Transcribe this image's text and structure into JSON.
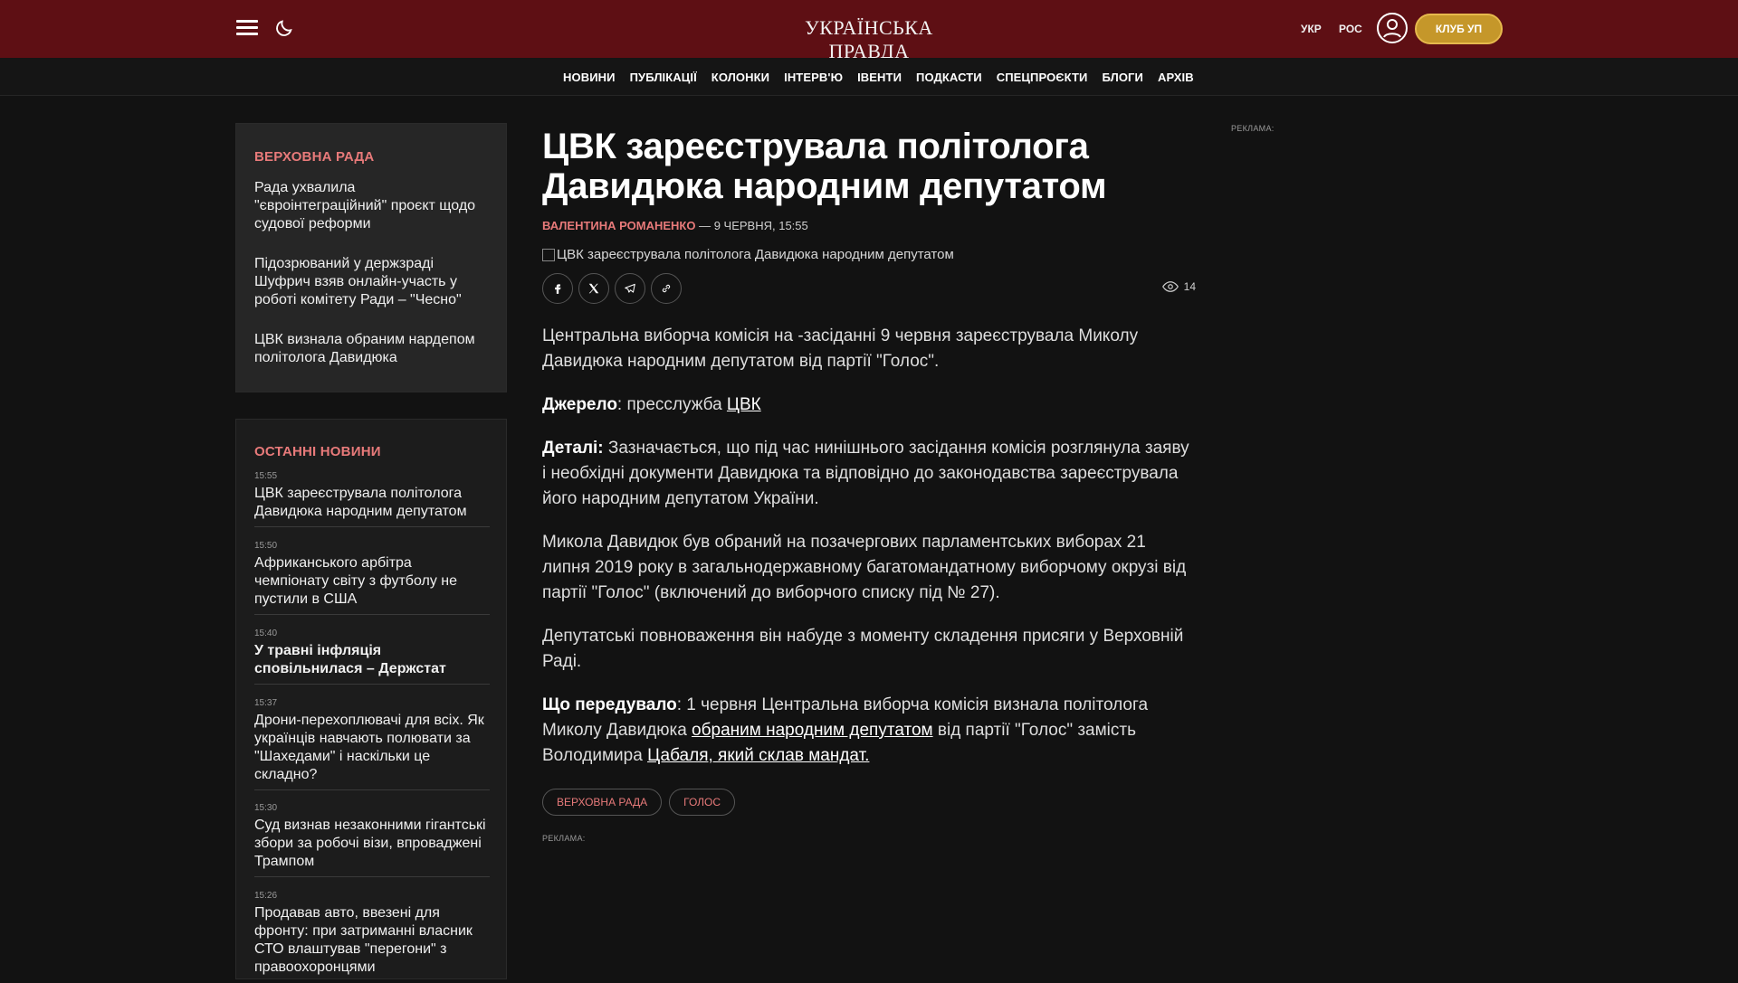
{
  "header": {
    "logo": "УКРАЇНСЬКА ПРАВДА",
    "lang_ukr": "УКР",
    "lang_ros": "РОС",
    "club": "КЛУБ УП"
  },
  "nav": [
    "НОВИНИ",
    "ПУБЛІКАЦІЇ",
    "КОЛОНКИ",
    "ІНТЕРВ'Ю",
    "ІВЕНТИ",
    "ПОДКАСТИ",
    "СПЕЦПРОЄКТИ",
    "БЛОГИ",
    "АРХІВ"
  ],
  "rada_box": {
    "title": "ВЕРХОВНА РАДА",
    "items": [
      "Рада ухвалила \"євроінтеграційний\" проєкт щодо судової реформи",
      "Підозрюваний у держзраді Шуфрич взяв онлайн-участь у роботі комітету Ради – \"Чесно\"",
      "ЦВК визнала обраним нардепом політолога Давидюка"
    ]
  },
  "latest_box": {
    "title": "ОСТАННІ НОВИНИ",
    "items": [
      {
        "time": "15:55",
        "title": "ЦВК зареєструвала політолога Давидюка народним депутатом"
      },
      {
        "time": "15:50",
        "title": "Африканського арбітра чемпіонату світу з футболу не пустили в США"
      },
      {
        "time": "15:40",
        "title": "У травні інфляція сповільнилася – Держстат"
      },
      {
        "time": "15:37",
        "title": "Дрони-перехоплювачі для всіх. Як українців навчають полювати за \"Шахедами\" і наскільки це складно?"
      },
      {
        "time": "15:30",
        "title": "Суд визнав незаконними гігантські збори за робочі візи, впроваджені Трампом"
      },
      {
        "time": "15:26",
        "title": "Продавав авто, ввезені для фронту: при затриманні власник СТО влаштував \"перегони\" з правоохоронцями"
      }
    ]
  },
  "article": {
    "headline": "ЦВК зареєструвала політолога Давидюка народним депутатом",
    "author": "ВАЛЕНТИНА РОМАНЕНКО",
    "date": "— 9 ЧЕРВНЯ, 15:55",
    "image_alt": "ЦВК зареєструвала політолога Давидюка народним депутатом",
    "views": "14",
    "p1": "Центральна виборча комісія на -засіданні 9 червня зареєструвала Миколу Давидюка народним депутатом від партії \"Голос\".",
    "p2_label": "Джерело",
    "p2_text": ": пресслужба ",
    "p2_link": "ЦВК",
    "p3_label": "Деталі:",
    "p3_text": " Зазначається, що під час нинішнього засідання комісія розглянула заяву і необхідні документи Давидюка та відповідно до законодавства зареєструвала його народним депутатом України.",
    "p4": "Микола Давидюк був обраний на позачергових парламентських виборах 21 липня 2019 року в загальнодержавному багатомандатному виборчому окрузі від партії \"Голос\" (включений до виборчого списку під № 27).",
    "p5": "Депутатські повноваження він набуде з моменту складення присяги у Верховній Раді.",
    "p6_label": "Що передувало",
    "p6_text": ": 1 червня Центральна виборча комісія визнала політолога Миколу Давидюка ",
    "p6_link1": "обраним народним депутатом",
    "p6_text2": " від партії \"Голос\" замість Володимира ",
    "p6_link2": "Цабаля, який склав мандат.",
    "tags": [
      "ВЕРХОВНА РАДА",
      "ГОЛОС"
    ],
    "ad_label": "РЕКЛАМА:"
  },
  "right_ad_label": "РЕКЛАМА:",
  "colors": {
    "topbar": "#5e0f14",
    "accent": "#e87a7a",
    "club": "#c5972a"
  }
}
